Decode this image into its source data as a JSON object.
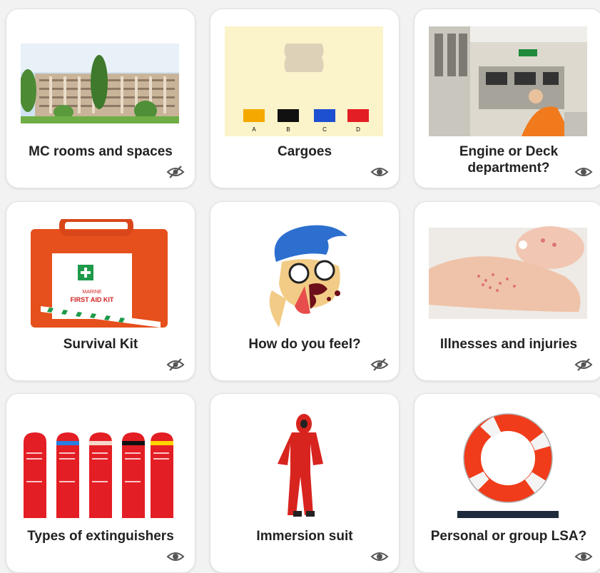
{
  "cards": [
    {
      "title": "MC rooms and spaces",
      "visibility_icon": "eye-slash-icon",
      "image": "building-photo"
    },
    {
      "title": "Cargoes",
      "visibility_icon": "eye-icon",
      "image": "cargo-colour-swatches",
      "swatches": [
        {
          "letter": "A",
          "color": "#f5a800"
        },
        {
          "letter": "B",
          "color": "#111111"
        },
        {
          "letter": "C",
          "color": "#1d4fd1"
        },
        {
          "letter": "D",
          "color": "#e31e24"
        }
      ]
    },
    {
      "title": "Engine or Deck department?",
      "visibility_icon": "eye-icon",
      "image": "engine-control-room-photo"
    },
    {
      "title": "Survival Kit",
      "visibility_icon": "eye-slash-icon",
      "image": "first-aid-kit-photo",
      "kit_label": "FIRST AID KIT",
      "kit_label_top": "MARINE"
    },
    {
      "title": "How do you feel?",
      "visibility_icon": "eye-slash-icon",
      "image": "nosebleed-cartoon"
    },
    {
      "title": "Illnesses and injuries",
      "visibility_icon": "eye-slash-icon",
      "image": "rash-arm-photo"
    },
    {
      "title": "Types of extinguishers",
      "visibility_icon": "eye-icon",
      "image": "extinguisher-signs"
    },
    {
      "title": "Immersion suit",
      "visibility_icon": "eye-icon",
      "image": "immersion-suit-photo"
    },
    {
      "title": "Personal or group LSA?",
      "visibility_icon": "eye-icon",
      "image": "lifebuoy-photo"
    }
  ]
}
